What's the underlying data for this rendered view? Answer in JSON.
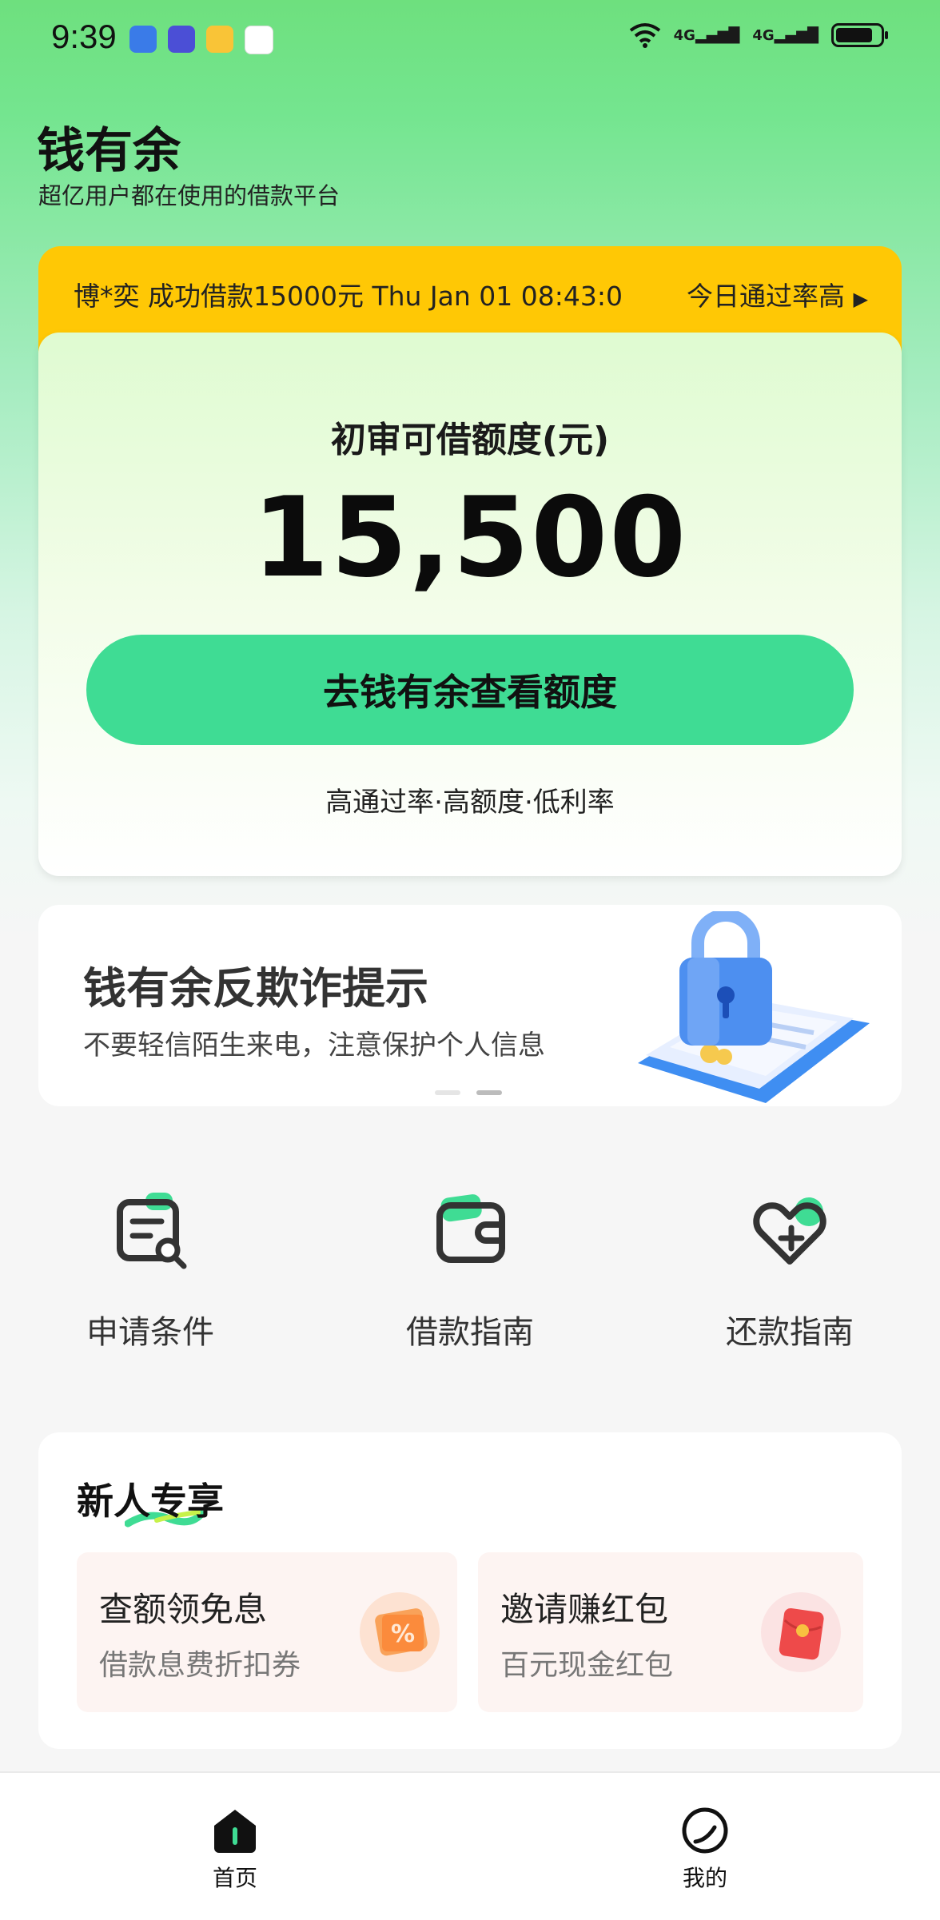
{
  "status_bar": {
    "time": "9:39",
    "signal_1": "4G",
    "signal_2": "4G"
  },
  "header": {
    "title": "钱有余",
    "subtitle": "超亿用户都在使用的借款平台"
  },
  "ticker": {
    "message": "博*奕 成功借款15000元   Thu Jan 01 08:43:0",
    "right_label": "今日通过率高"
  },
  "credit": {
    "label": "初审可借额度(元)",
    "amount": "15,500",
    "button": "去钱有余查看额度",
    "features": "高通过率·高额度·低利率"
  },
  "banner": {
    "title": "钱有余反欺诈提示",
    "subtitle": "不要轻信陌生来电，注意保护个人信息",
    "slide_count": 2,
    "active_slide": 2
  },
  "quick_nav": [
    {
      "label": "申请条件",
      "icon": "document-search-icon"
    },
    {
      "label": "借款指南",
      "icon": "wallet-icon"
    },
    {
      "label": "还款指南",
      "icon": "heart-plus-icon"
    }
  ],
  "newbie": {
    "title": "新人专享",
    "cards": [
      {
        "title": "查额领免息",
        "subtitle": "借款息费折扣券",
        "icon": "coupon-percent-icon"
      },
      {
        "title": "邀请赚红包",
        "subtitle": "百元现金红包",
        "icon": "red-envelope-icon"
      }
    ]
  },
  "bottom_nav": [
    {
      "label": "首页",
      "icon": "home-icon",
      "active": true
    },
    {
      "label": "我的",
      "icon": "profile-icon",
      "active": false
    }
  ],
  "colors": {
    "accent_green": "#3fdc94",
    "ticker_yellow": "#ffc805"
  }
}
